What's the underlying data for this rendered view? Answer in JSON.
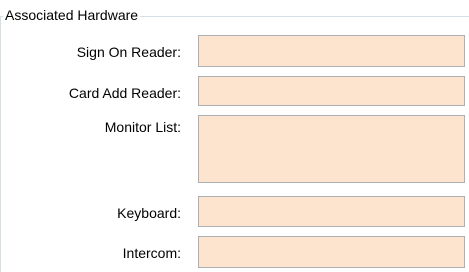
{
  "group": {
    "title": "Associated Hardware"
  },
  "fields": {
    "sign_on_reader": {
      "label": "Sign On Reader:",
      "value": ""
    },
    "card_add_reader": {
      "label": "Card Add Reader:",
      "value": ""
    },
    "monitor_list": {
      "label": "Monitor List:",
      "value": ""
    },
    "keyboard": {
      "label": "Keyboard:",
      "value": ""
    },
    "intercom": {
      "label": "Intercom:",
      "value": ""
    }
  },
  "colors": {
    "field_background": "#fce4cf",
    "field_border": "#aab0b6",
    "group_border": "#d5dfe5"
  }
}
